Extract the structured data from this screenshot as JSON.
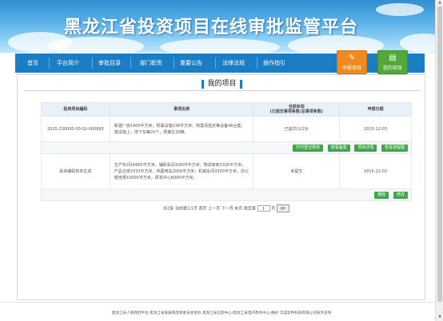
{
  "header": {
    "title": "黑龙江省投资项目在线审批监管平台"
  },
  "nav": {
    "items": [
      {
        "label": "首页"
      },
      {
        "label": "平台简介"
      },
      {
        "label": "审批目录"
      },
      {
        "label": "部门职责"
      },
      {
        "label": "重要公告"
      },
      {
        "label": "法律法规"
      },
      {
        "label": "操作指引"
      }
    ],
    "apply_label": "申报项目",
    "my_projects_label": "我的项目"
  },
  "page": {
    "title": "我的项目"
  },
  "table": {
    "headers": {
      "code": "投资项目编码",
      "name": "事项名称",
      "status": "当前状态",
      "status_sub": "(已提交事项条数/总事项条数)",
      "date": "申报日期"
    },
    "rows": [
      {
        "code": "2015-230000-00-02-000865",
        "name": "新建厂房1400平方米，附属设施238平方米，购置另指定等设备46台套，建设施上，地下车辆20个，购播生20辆。",
        "status": "已提交(1/19)",
        "date": "2015-12-03"
      },
      {
        "code": "投资编码暂未生成",
        "name": "生产车间16665平方米，辅助车间10005平方米，物流库房3330平方米，产品仓库3333平方米，热图电站2000平方米，机械车间3330平方米，办公楼含楼10000平方米，研发中心6000平方米。",
        "status": "未提交",
        "date": "2015-12-03"
      }
    ],
    "row1_actions": [
      "打印登记表单",
      "查看备案",
      "项目详情",
      "查看流程图"
    ],
    "row2_actions": [
      "删除",
      "修改"
    ]
  },
  "pager": {
    "summary": "共2条 当前第1/1页",
    "first": "首页",
    "prev": "上一页",
    "next": "下一页",
    "last": "末页",
    "jump_label": "跳至第",
    "page_value": "1",
    "page_unit": "页",
    "go_label": "go"
  },
  "footer": {
    "text": "黑龙江省人民政府平台  黑龙江省发展和改革委员会承办  黑龙江省信息中心(黑龙江省电子政务中心)维护  华蓝软件科技有限公司技术支持"
  },
  "colors": {
    "nav_blue": "#1b7ec4",
    "apply_orange": "#f08a1e",
    "mine_green": "#53a83a",
    "action_green": "#41a64a"
  }
}
